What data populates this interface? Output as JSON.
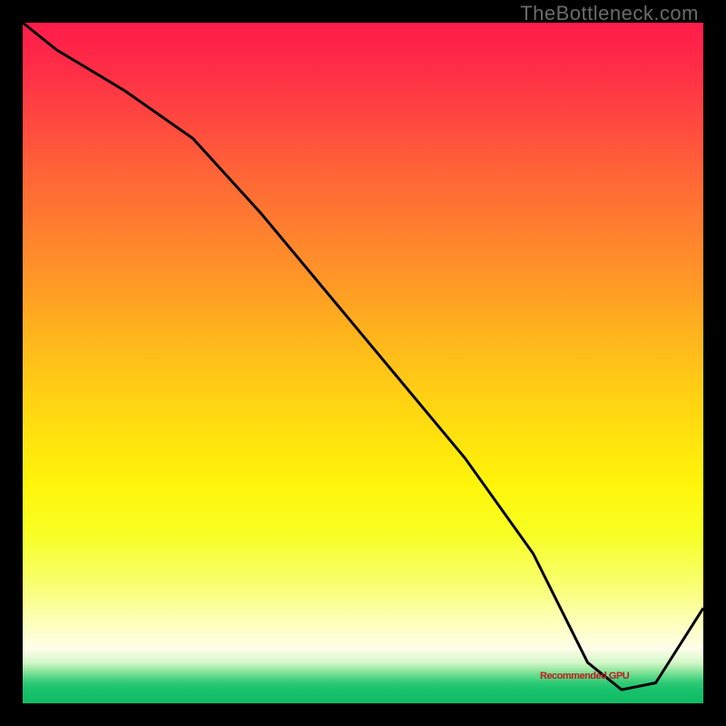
{
  "watermark": "TheBottleneck.com",
  "annotation_label": "Recommended GPU",
  "chart_data": {
    "type": "line",
    "title": "",
    "xlabel": "",
    "ylabel": "",
    "xlim": [
      0,
      100
    ],
    "ylim": [
      0,
      100
    ],
    "series": [
      {
        "name": "overlay-curve",
        "x": [
          0,
          5,
          15,
          25,
          35,
          45,
          55,
          65,
          75,
          83,
          88,
          93,
          100
        ],
        "values": [
          100,
          96,
          90,
          83,
          72,
          60,
          48,
          36,
          22,
          6,
          2,
          3,
          14
        ]
      }
    ],
    "gradient_bands": [
      {
        "y": 100,
        "color": "#ff1b4a"
      },
      {
        "y": 93,
        "color": "#ff2e46"
      },
      {
        "y": 85,
        "color": "#ff4a3f"
      },
      {
        "y": 78,
        "color": "#ff6437"
      },
      {
        "y": 70,
        "color": "#ff7e2f"
      },
      {
        "y": 62,
        "color": "#ff9826"
      },
      {
        "y": 55,
        "color": "#ffb11d"
      },
      {
        "y": 47,
        "color": "#ffcb15"
      },
      {
        "y": 40,
        "color": "#ffe00e"
      },
      {
        "y": 32,
        "color": "#fff50a"
      },
      {
        "y": 25,
        "color": "#f7ff23"
      },
      {
        "y": 18,
        "color": "#f8ff6a"
      },
      {
        "y": 12,
        "color": "#fdffb8"
      },
      {
        "y": 8,
        "color": "#fefeea"
      },
      {
        "y": 6,
        "color": "#d4f7c9"
      },
      {
        "y": 5,
        "color": "#9de9a6"
      },
      {
        "y": 4,
        "color": "#5fd98b"
      },
      {
        "y": 3,
        "color": "#2fca76"
      },
      {
        "y": 2,
        "color": "#18c26c"
      },
      {
        "y": 0,
        "color": "#0fbb65"
      }
    ],
    "annotation": {
      "x": 84,
      "y": 4,
      "label_key": "annotation_label"
    }
  }
}
